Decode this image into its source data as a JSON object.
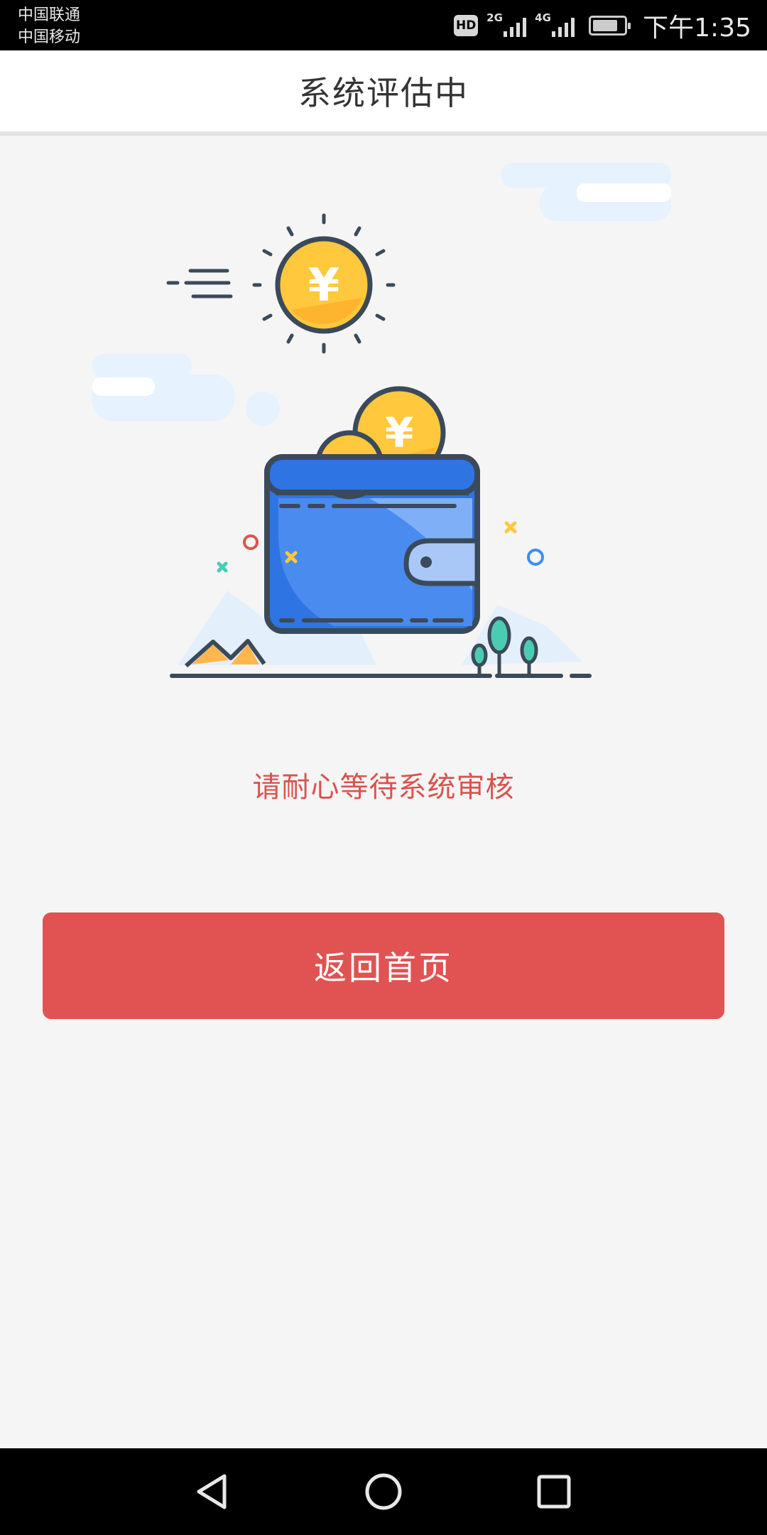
{
  "status_bar": {
    "carrier_1": "中国联通",
    "carrier_2": "中国移动",
    "hd_badge": "HD",
    "network_1": "2G",
    "network_2": "4G",
    "time": "下午1:35"
  },
  "header": {
    "title": "系统评估中"
  },
  "illustration": {
    "currency_symbol": "¥",
    "icon": "wallet-with-coins-illustration"
  },
  "main": {
    "message": "请耐心等待系统审核",
    "home_button_label": "返回首页"
  },
  "system_nav": {
    "back_icon": "back-triangle-icon",
    "home_icon": "home-circle-icon",
    "recents_icon": "recents-square-icon"
  },
  "colors": {
    "accent_red": "#e05352",
    "message_red": "#d9534f",
    "wallet_blue": "#2f74e3",
    "coin_yellow": "#ffc83d"
  }
}
